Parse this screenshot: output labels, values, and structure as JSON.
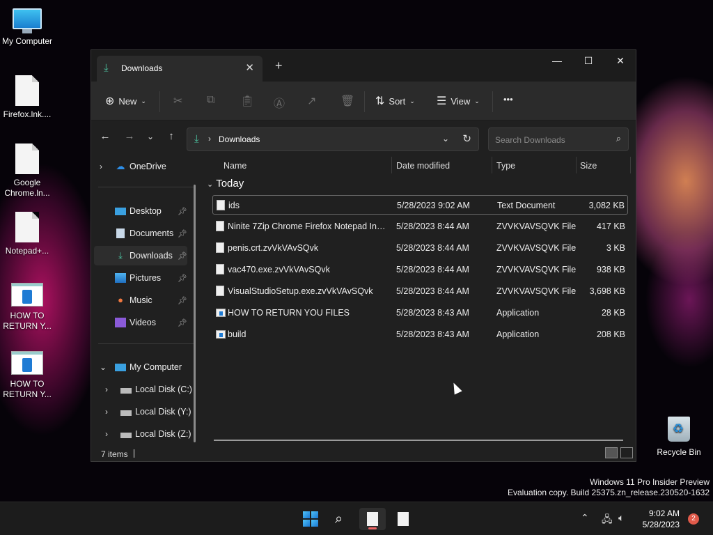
{
  "desktop": {
    "icons": [
      {
        "label": "My Computer"
      },
      {
        "label": "Firefox.lnk...."
      },
      {
        "label": "Google Chrome.ln..."
      },
      {
        "label": "Notepad+..."
      },
      {
        "label": "HOW TO RETURN Y..."
      },
      {
        "label": "HOW TO RETURN Y..."
      }
    ],
    "recycle_bin": "Recycle Bin",
    "watermark_line1": "Windows 11 Pro Insider Preview",
    "watermark_line2": "Evaluation copy. Build 25375.zn_release.230520-1632"
  },
  "explorer": {
    "tab_title": "Downloads",
    "toolbar": {
      "new_label": "New",
      "sort_label": "Sort",
      "view_label": "View",
      "more_label": "•••"
    },
    "address": {
      "path": "Downloads",
      "search_placeholder": "Search Downloads"
    },
    "sidebar": {
      "onedrive": "OneDrive",
      "quick": [
        {
          "label": "Desktop",
          "icon": "desktop-icon"
        },
        {
          "label": "Documents",
          "icon": "documents-icon"
        },
        {
          "label": "Downloads",
          "icon": "downloads-icon"
        },
        {
          "label": "Pictures",
          "icon": "pictures-icon"
        },
        {
          "label": "Music",
          "icon": "music-icon"
        },
        {
          "label": "Videos",
          "icon": "videos-icon"
        }
      ],
      "my_computer": "My Computer",
      "drives": [
        "Local Disk (C:)",
        "Local Disk (Y:)",
        "Local Disk (Z:)"
      ]
    },
    "columns": {
      "name": "Name",
      "date": "Date modified",
      "type": "Type",
      "size": "Size"
    },
    "group": "Today",
    "files": [
      {
        "name": "ids",
        "date": "5/28/2023 9:02 AM",
        "type": "Text Document",
        "size": "3,082 KB",
        "icon": "text-file-icon"
      },
      {
        "name": "Ninite 7Zip Chrome Firefox Notepad Inst...",
        "date": "5/28/2023 8:44 AM",
        "type": "ZVVKVAVSQVK File",
        "size": "417 KB",
        "icon": "file-icon"
      },
      {
        "name": "penis.crt.zvVkVAvSQvk",
        "date": "5/28/2023 8:44 AM",
        "type": "ZVVKVAVSQVK File",
        "size": "3 KB",
        "icon": "file-icon"
      },
      {
        "name": "vac470.exe.zvVkVAvSQvk",
        "date": "5/28/2023 8:44 AM",
        "type": "ZVVKVAVSQVK File",
        "size": "938 KB",
        "icon": "file-icon"
      },
      {
        "name": "VisualStudioSetup.exe.zvVkVAvSQvk",
        "date": "5/28/2023 8:44 AM",
        "type": "ZVVKVAVSQVK File",
        "size": "3,698 KB",
        "icon": "file-icon"
      },
      {
        "name": "HOW TO RETURN YOU FILES",
        "date": "5/28/2023 8:43 AM",
        "type": "Application",
        "size": "28 KB",
        "icon": "application-icon"
      },
      {
        "name": "build",
        "date": "5/28/2023 8:43 AM",
        "type": "Application",
        "size": "208 KB",
        "icon": "application-icon"
      }
    ],
    "status": "7 items"
  },
  "taskbar": {
    "time": "9:02 AM",
    "date": "5/28/2023",
    "notification_count": "2"
  },
  "colors": {
    "accent": "#4cc2a0",
    "window_bg": "#202020",
    "badge": "#e05a4a"
  }
}
